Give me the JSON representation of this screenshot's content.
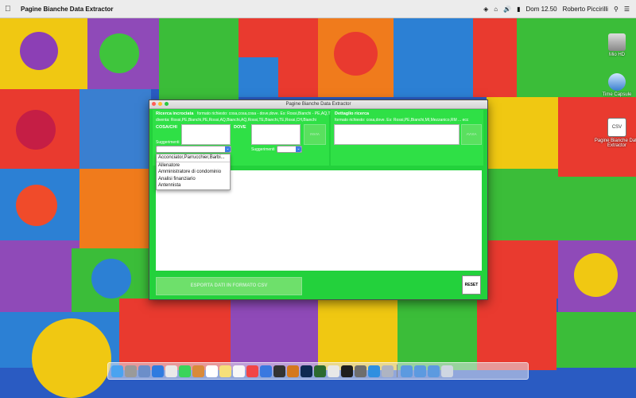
{
  "menubar": {
    "apple_icon": "apple-icon",
    "app_name": "Pagine Bianche Data Extractor",
    "clock": "Dom 12.50",
    "user": "Roberto Piccirilli"
  },
  "desktop": {
    "icons": [
      {
        "label": "Mio HD"
      },
      {
        "label": "Time Capsule"
      },
      {
        "label": "Pagine Bianche Data Extractor"
      }
    ]
  },
  "window": {
    "title": "Pagine Bianche Data Extractor",
    "ricerca": {
      "heading": "Ricerca incrociata",
      "format_hint": "formato richiesto: cosa,cosa,cosa - dove,dove.  Es: Rossi,Bianchi - PE,AQ,TE,CH",
      "example": "diventa: Rossi,PE,Bianchi,PE,Rossi,AQ,Bianchi,AQ,Rossi,TE,Bianchi,TE,Rossi,CH,Bianchi",
      "cosa_label": "COSA/CHI",
      "dove_label": "DOVE",
      "cerca_button": "INVIA",
      "suggestions_label_1": "Suggerimenti",
      "suggestions_label_2": "Suggerimenti"
    },
    "dettaglio": {
      "heading": "Dettaglio ricerca",
      "format_hint": "formato richiesto: cosa,dove. Es: Rossi,PE,Bianchi,MI,Mezzanico,RM ... ecc",
      "avvia_button": "AVVIA"
    },
    "dropdown_items": [
      "Acconciator,Parrucchier,Barbi...",
      "Allenatore",
      "Amministratore di condominio",
      "Analisi finanziario",
      "Antennista"
    ],
    "export_button": "ESPORTA DATI IN FORMATO CSV",
    "reset_button": "RESET"
  }
}
